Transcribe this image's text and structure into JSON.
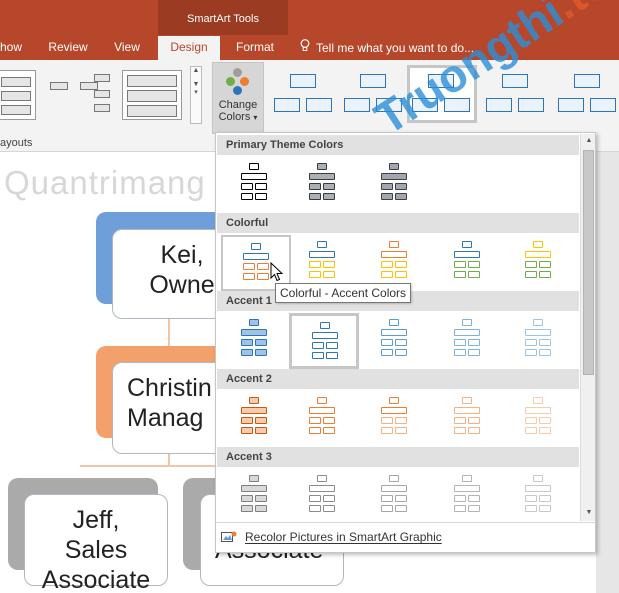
{
  "ribbon": {
    "contextual_title": "SmartArt Tools",
    "tabs": [
      "how",
      "Review",
      "View",
      "Design",
      "Format"
    ],
    "active_tab": "Design",
    "tell_me": "Tell me what you want to do...",
    "layouts_group_label": "ayouts",
    "change_colors_label_1": "Change",
    "change_colors_label_2": "Colors",
    "change_colors_caret": "▾",
    "colors": {
      "ribbon_red": "#b7472a",
      "contextual": "#9a3b22"
    }
  },
  "dropdown": {
    "sections": [
      {
        "title": "Primary Theme Colors",
        "options": [
          {
            "border": "#000000",
            "fill": "#ffffff",
            "stroke2": "#000000"
          },
          {
            "border": "#3a3a3a",
            "fill": "#aab0b8",
            "stroke2": "#3a3a3a"
          },
          {
            "border": "#404040",
            "fill": "#a0a7b0",
            "stroke2": "#404040"
          }
        ]
      },
      {
        "title": "Colorful",
        "options": [
          {
            "border": "#2e75b6",
            "fill": "#ffffff",
            "stroke2": "#ed7d31"
          },
          {
            "border": "#2e75b6",
            "fill": "#ffffff",
            "stroke2": "#ffc000"
          },
          {
            "border": "#ed7d31",
            "fill": "#ffffff",
            "stroke2": "#ffc000"
          },
          {
            "border": "#2e75b6",
            "fill": "#ffffff",
            "stroke2": "#70ad47"
          },
          {
            "border": "#ffc000",
            "fill": "#ffffff",
            "stroke2": "#70ad47"
          }
        ]
      },
      {
        "title": "Accent 1",
        "options": [
          {
            "border": "#2e75b6",
            "fill": "#9dc3e6",
            "stroke2": "#2e75b6"
          },
          {
            "border": "#2e75b6",
            "fill": "#ffffff",
            "stroke2": "#2e75b6"
          },
          {
            "border": "#5b9bd5",
            "fill": "#ffffff",
            "stroke2": "#5b9bd5"
          },
          {
            "border": "#7fb2e0",
            "fill": "#ffffff",
            "stroke2": "#7fb2e0"
          },
          {
            "border": "#9dc3e6",
            "fill": "#ffffff",
            "stroke2": "#9dc3e6"
          }
        ]
      },
      {
        "title": "Accent 2",
        "options": [
          {
            "border": "#c55a11",
            "fill": "#f8cbad",
            "stroke2": "#c55a11"
          },
          {
            "border": "#ed7d31",
            "fill": "#ffffff",
            "stroke2": "#ed7d31"
          },
          {
            "border": "#ed7d31",
            "fill": "#ffffff",
            "stroke2": "#f4b183"
          },
          {
            "border": "#f4b183",
            "fill": "#ffffff",
            "stroke2": "#f4b183"
          },
          {
            "border": "#f8cbad",
            "fill": "#ffffff",
            "stroke2": "#f8cbad"
          }
        ]
      },
      {
        "title": "Accent 3",
        "options": [
          {
            "border": "#7f7f7f",
            "fill": "#d9d9d9",
            "stroke2": "#7f7f7f"
          },
          {
            "border": "#8c8c8c",
            "fill": "#ffffff",
            "stroke2": "#8c8c8c"
          },
          {
            "border": "#a6a6a6",
            "fill": "#ffffff",
            "stroke2": "#a6a6a6"
          },
          {
            "border": "#b4b4b4",
            "fill": "#ffffff",
            "stroke2": "#b4b4b4"
          },
          {
            "border": "#c8c8c8",
            "fill": "#ffffff",
            "stroke2": "#c8c8c8"
          }
        ]
      }
    ],
    "tooltip": "Colorful - Accent Colors",
    "recolor_label": "Recolor Pictures in SmartArt Graphic",
    "scroll_up": "▲",
    "scroll_down": "▼",
    "grip": "....."
  },
  "canvas": {
    "nodes": {
      "owner": [
        "Kei,",
        "Owne"
      ],
      "manager": [
        "Christin",
        "Manag"
      ],
      "associate_1": [
        "Jeff, Sales",
        "Associate"
      ],
      "associate_2": [
        "Associate"
      ]
    },
    "colors": {
      "owner_fill": "#6f9fd8",
      "manager_fill": "#f4a06a",
      "associate_fill": "#aaaaaa"
    }
  },
  "watermark": {
    "text": "Quantrimang",
    "diagonal_main": "Truongthi",
    "diagonal_accent": ".top"
  }
}
